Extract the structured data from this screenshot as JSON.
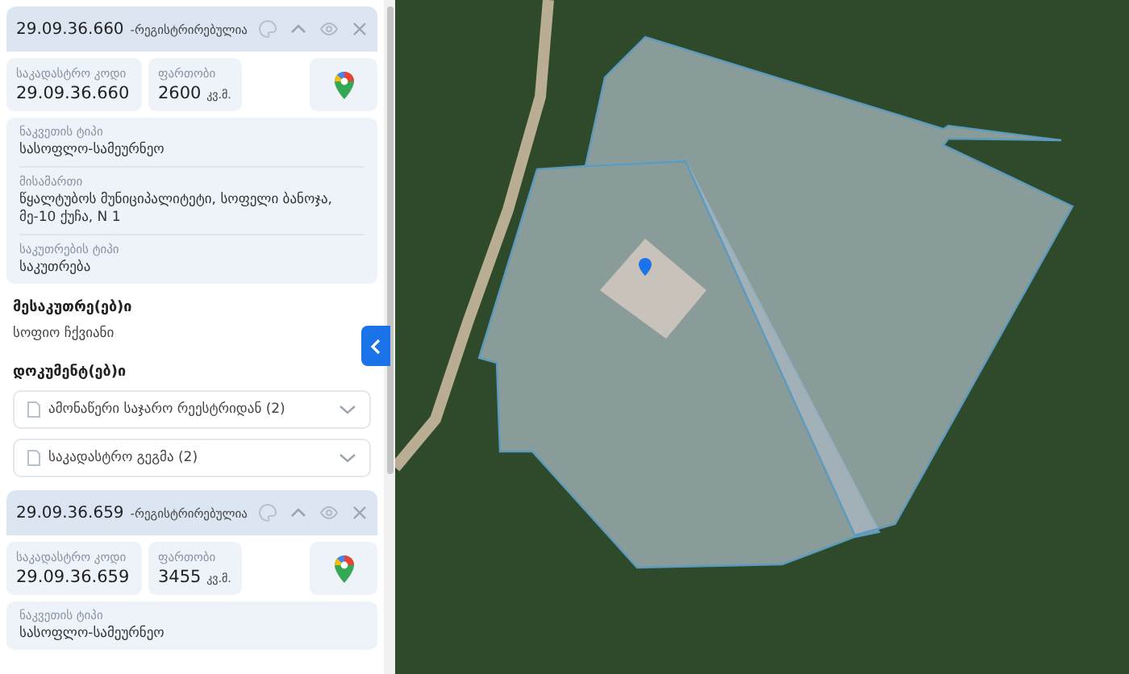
{
  "parcels": [
    {
      "code": "29.09.36.660",
      "status": "-რეგისტრირებულია",
      "code_label": "საკადასტრო კოდი",
      "code_value": "29.09.36.660",
      "area_label": "ფართობი",
      "area": "2600",
      "unit": "კვ.მ.",
      "details": [
        {
          "label": "ნაკვეთის ტიპი",
          "value": "სასოფლო-სამეურნეო"
        },
        {
          "label": "მისამართი",
          "value": "წყალტუბოს მუნიციპალიტეტი, სოფელი ბანოჯა, მე-10 ქუჩა, N 1"
        },
        {
          "label": "საკუთრების ტიპი",
          "value": "საკუთრება"
        }
      ],
      "owners_title": "მესაკუთრე(ებ)ი",
      "owners": [
        "სოფიო ჩქვიანი"
      ],
      "documents_title": "დოკუმენტ(ებ)ი",
      "documents": [
        {
          "label": "ამონაწერი საჯარო რეესტრიდან (2)",
          "expanded": false
        },
        {
          "label": "საკადასტრო გეგმა (2)",
          "expanded": false
        }
      ]
    },
    {
      "code": "29.09.36.659",
      "status": "-რეგისტრირებულია",
      "code_label": "საკადასტრო კოდი",
      "code_value": "29.09.36.659",
      "area_label": "ფართობი",
      "area": "3455",
      "unit": "კვ.მ.",
      "details": [
        {
          "label": "ნაკვეთის ტიპი",
          "value": "სასოფლო-სამეურნეო"
        }
      ]
    }
  ]
}
